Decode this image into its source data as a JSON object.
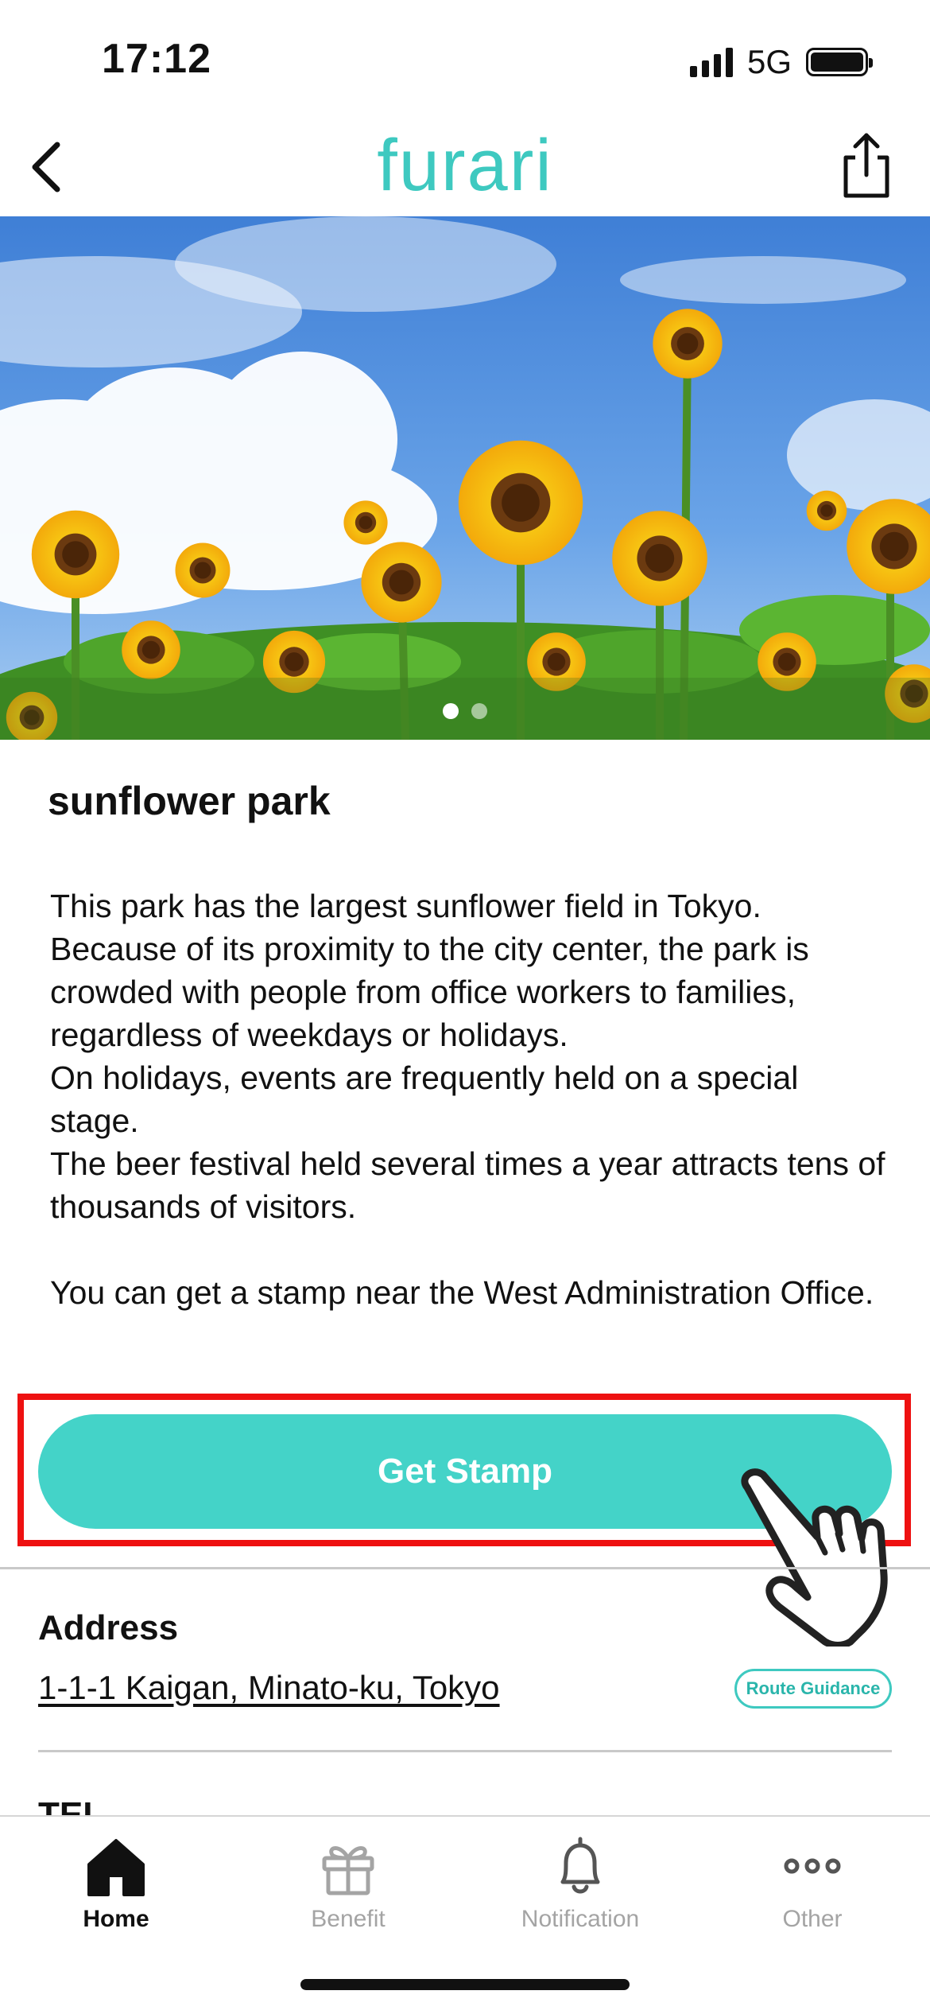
{
  "status_bar": {
    "time": "17:12",
    "network": "5G"
  },
  "nav": {
    "logo": "furari"
  },
  "hero": {
    "image": "sunflower-field-photo",
    "dots": 2,
    "active_dot": 1
  },
  "spot": {
    "title": "sunflower park",
    "description": "This park has the largest sunflower field in Tokyo.\nBecause of its proximity to the city center, the park is crowded with people from office workers to families, regardless of weekdays or holidays.\nOn holidays, events are frequently held on a special stage.\nThe beer festival held several times a year attracts tens of thousands of visitors.\n\nYou can get a stamp near the West Administration Office."
  },
  "stamp_button": {
    "label": "Get Stamp"
  },
  "address": {
    "label": "Address",
    "value": "1-1-1 Kaigan, Minato-ku, Tokyo",
    "route_label": "Route Guidance"
  },
  "tel": {
    "label": "TEL"
  },
  "tab_bar": {
    "items": [
      {
        "label": "Home",
        "icon": "home-icon",
        "active": true
      },
      {
        "label": "Benefit",
        "icon": "gift-icon",
        "active": false
      },
      {
        "label": "Notification",
        "icon": "bell-icon",
        "active": false
      },
      {
        "label": "Other",
        "icon": "more-icon",
        "active": false
      }
    ]
  },
  "colors": {
    "accent": "#44d3c8",
    "highlight": "#ee1111",
    "logo": "#3ec9c0"
  }
}
